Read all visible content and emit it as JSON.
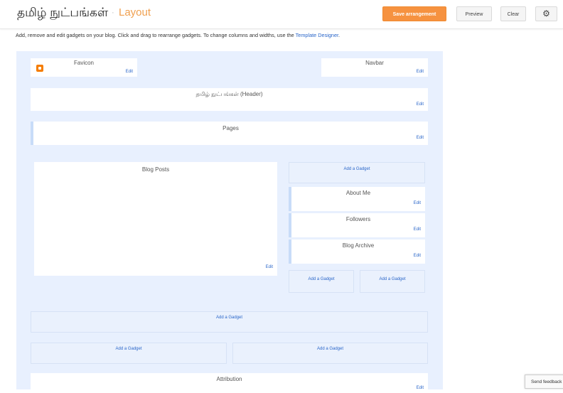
{
  "header": {
    "blog_title": "தமிழ் நுட்பங்கள்",
    "separator": "·",
    "section_title": "Layout",
    "save_button": "Save arrangement",
    "preview_button": "Preview",
    "clear_button": "Clear",
    "gear_icon": "⚙"
  },
  "instructions": {
    "text": "Add, remove and edit gadgets on your blog. Click and drag to rearrange gadgets. To change columns and widths, use the ",
    "link": "Template Designer",
    "suffix": "."
  },
  "gadgets": {
    "favicon": {
      "name": "Favicon",
      "edit": "Edit"
    },
    "navbar": {
      "name": "Navbar",
      "edit": "Edit"
    },
    "header": {
      "name": "தமிழ் நுட்பங்கள் (Header)",
      "edit": "Edit"
    },
    "pages": {
      "name": "Pages",
      "edit": "Edit"
    },
    "blog_posts": {
      "name": "Blog Posts",
      "edit": "Edit"
    },
    "about_me": {
      "name": "About Me",
      "edit": "Edit"
    },
    "followers": {
      "name": "Followers",
      "edit": "Edit"
    },
    "blog_archive": {
      "name": "Blog Archive",
      "edit": "Edit"
    },
    "attribution": {
      "name": "Attribution",
      "edit": "Edit"
    }
  },
  "add_gadget_label": "Add a Gadget",
  "feedback_button": "Send feedback"
}
